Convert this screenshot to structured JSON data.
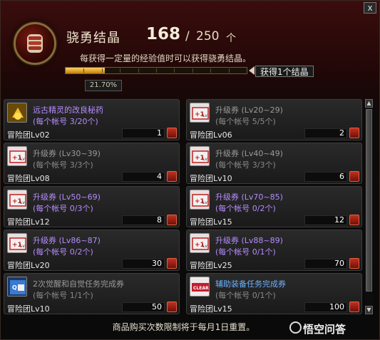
{
  "window": {
    "close_label": "x"
  },
  "header": {
    "title": "骁勇结晶",
    "current": "168",
    "separator": "/",
    "max": "250",
    "unit": "个",
    "description": "每获得一定量的经验值时可以获得骁勇结晶。",
    "tooltip": "获得1个结晶",
    "percent_label": "21.70%",
    "progress_fraction": 0.217
  },
  "items": [
    {
      "name": "远古精灵的改良秘药",
      "limit": "(每个帐号 3/20个)",
      "requirement": "冒险团Lv02",
      "price": "1",
      "icon": "potion-icon",
      "style": "purple"
    },
    {
      "name": "升级券 (Lv20~29)",
      "limit": "(每个帐号 5/5个)",
      "requirement": "冒险团Lv06",
      "price": "2",
      "icon": "levelup-ticket-icon",
      "style": "grey"
    },
    {
      "name": "升级券 (Lv30~39)",
      "limit": "(每个帐号 3/3个)",
      "requirement": "冒险团Lv08",
      "price": "4",
      "icon": "levelup-ticket-icon",
      "style": "grey"
    },
    {
      "name": "升级券 (Lv40~49)",
      "limit": "(每个帐号 3/3个)",
      "requirement": "冒险团Lv10",
      "price": "6",
      "icon": "levelup-ticket-icon",
      "style": "grey"
    },
    {
      "name": "升级券 (Lv50~69)",
      "limit": "(每个帐号 0/3个)",
      "requirement": "冒险团Lv12",
      "price": "8",
      "icon": "levelup-ticket-icon",
      "style": "purple"
    },
    {
      "name": "升级券 (Lv70~85)",
      "limit": "(每个帐号 0/2个)",
      "requirement": "冒险团Lv15",
      "price": "12",
      "icon": "levelup-ticket-icon",
      "style": "purple"
    },
    {
      "name": "升级券 (Lv86~87)",
      "limit": "(每个帐号 0/2个)",
      "requirement": "冒险团Lv20",
      "price": "30",
      "icon": "levelup-ticket-icon",
      "style": "purple"
    },
    {
      "name": "升级券 (Lv88~89)",
      "limit": "(每个帐号 0/1个)",
      "requirement": "冒险团Lv25",
      "price": "70",
      "icon": "levelup-ticket-icon",
      "style": "purple"
    },
    {
      "name": "2次觉醒和自觉任务完成券",
      "limit": "(每个帐号 1/1个)",
      "requirement": "冒险团Lv10",
      "price": "50",
      "icon": "awakening-quest-ticket-icon",
      "style": "grey"
    },
    {
      "name": "辅助装备任务完成券",
      "limit": "(每个帐号 0/1个)",
      "requirement": "冒险团Lv15",
      "price": "100",
      "icon": "equipment-quest-ticket-icon",
      "style": "blue"
    }
  ],
  "footer": {
    "notice": "商品购买次数限制将于每月1日重置。"
  },
  "watermark": {
    "text": "悟空问答"
  },
  "colors": {
    "purple": "#b58cff",
    "grey": "#9a9a9a",
    "blue": "#6fb0ff",
    "accent": "#e0a020"
  }
}
